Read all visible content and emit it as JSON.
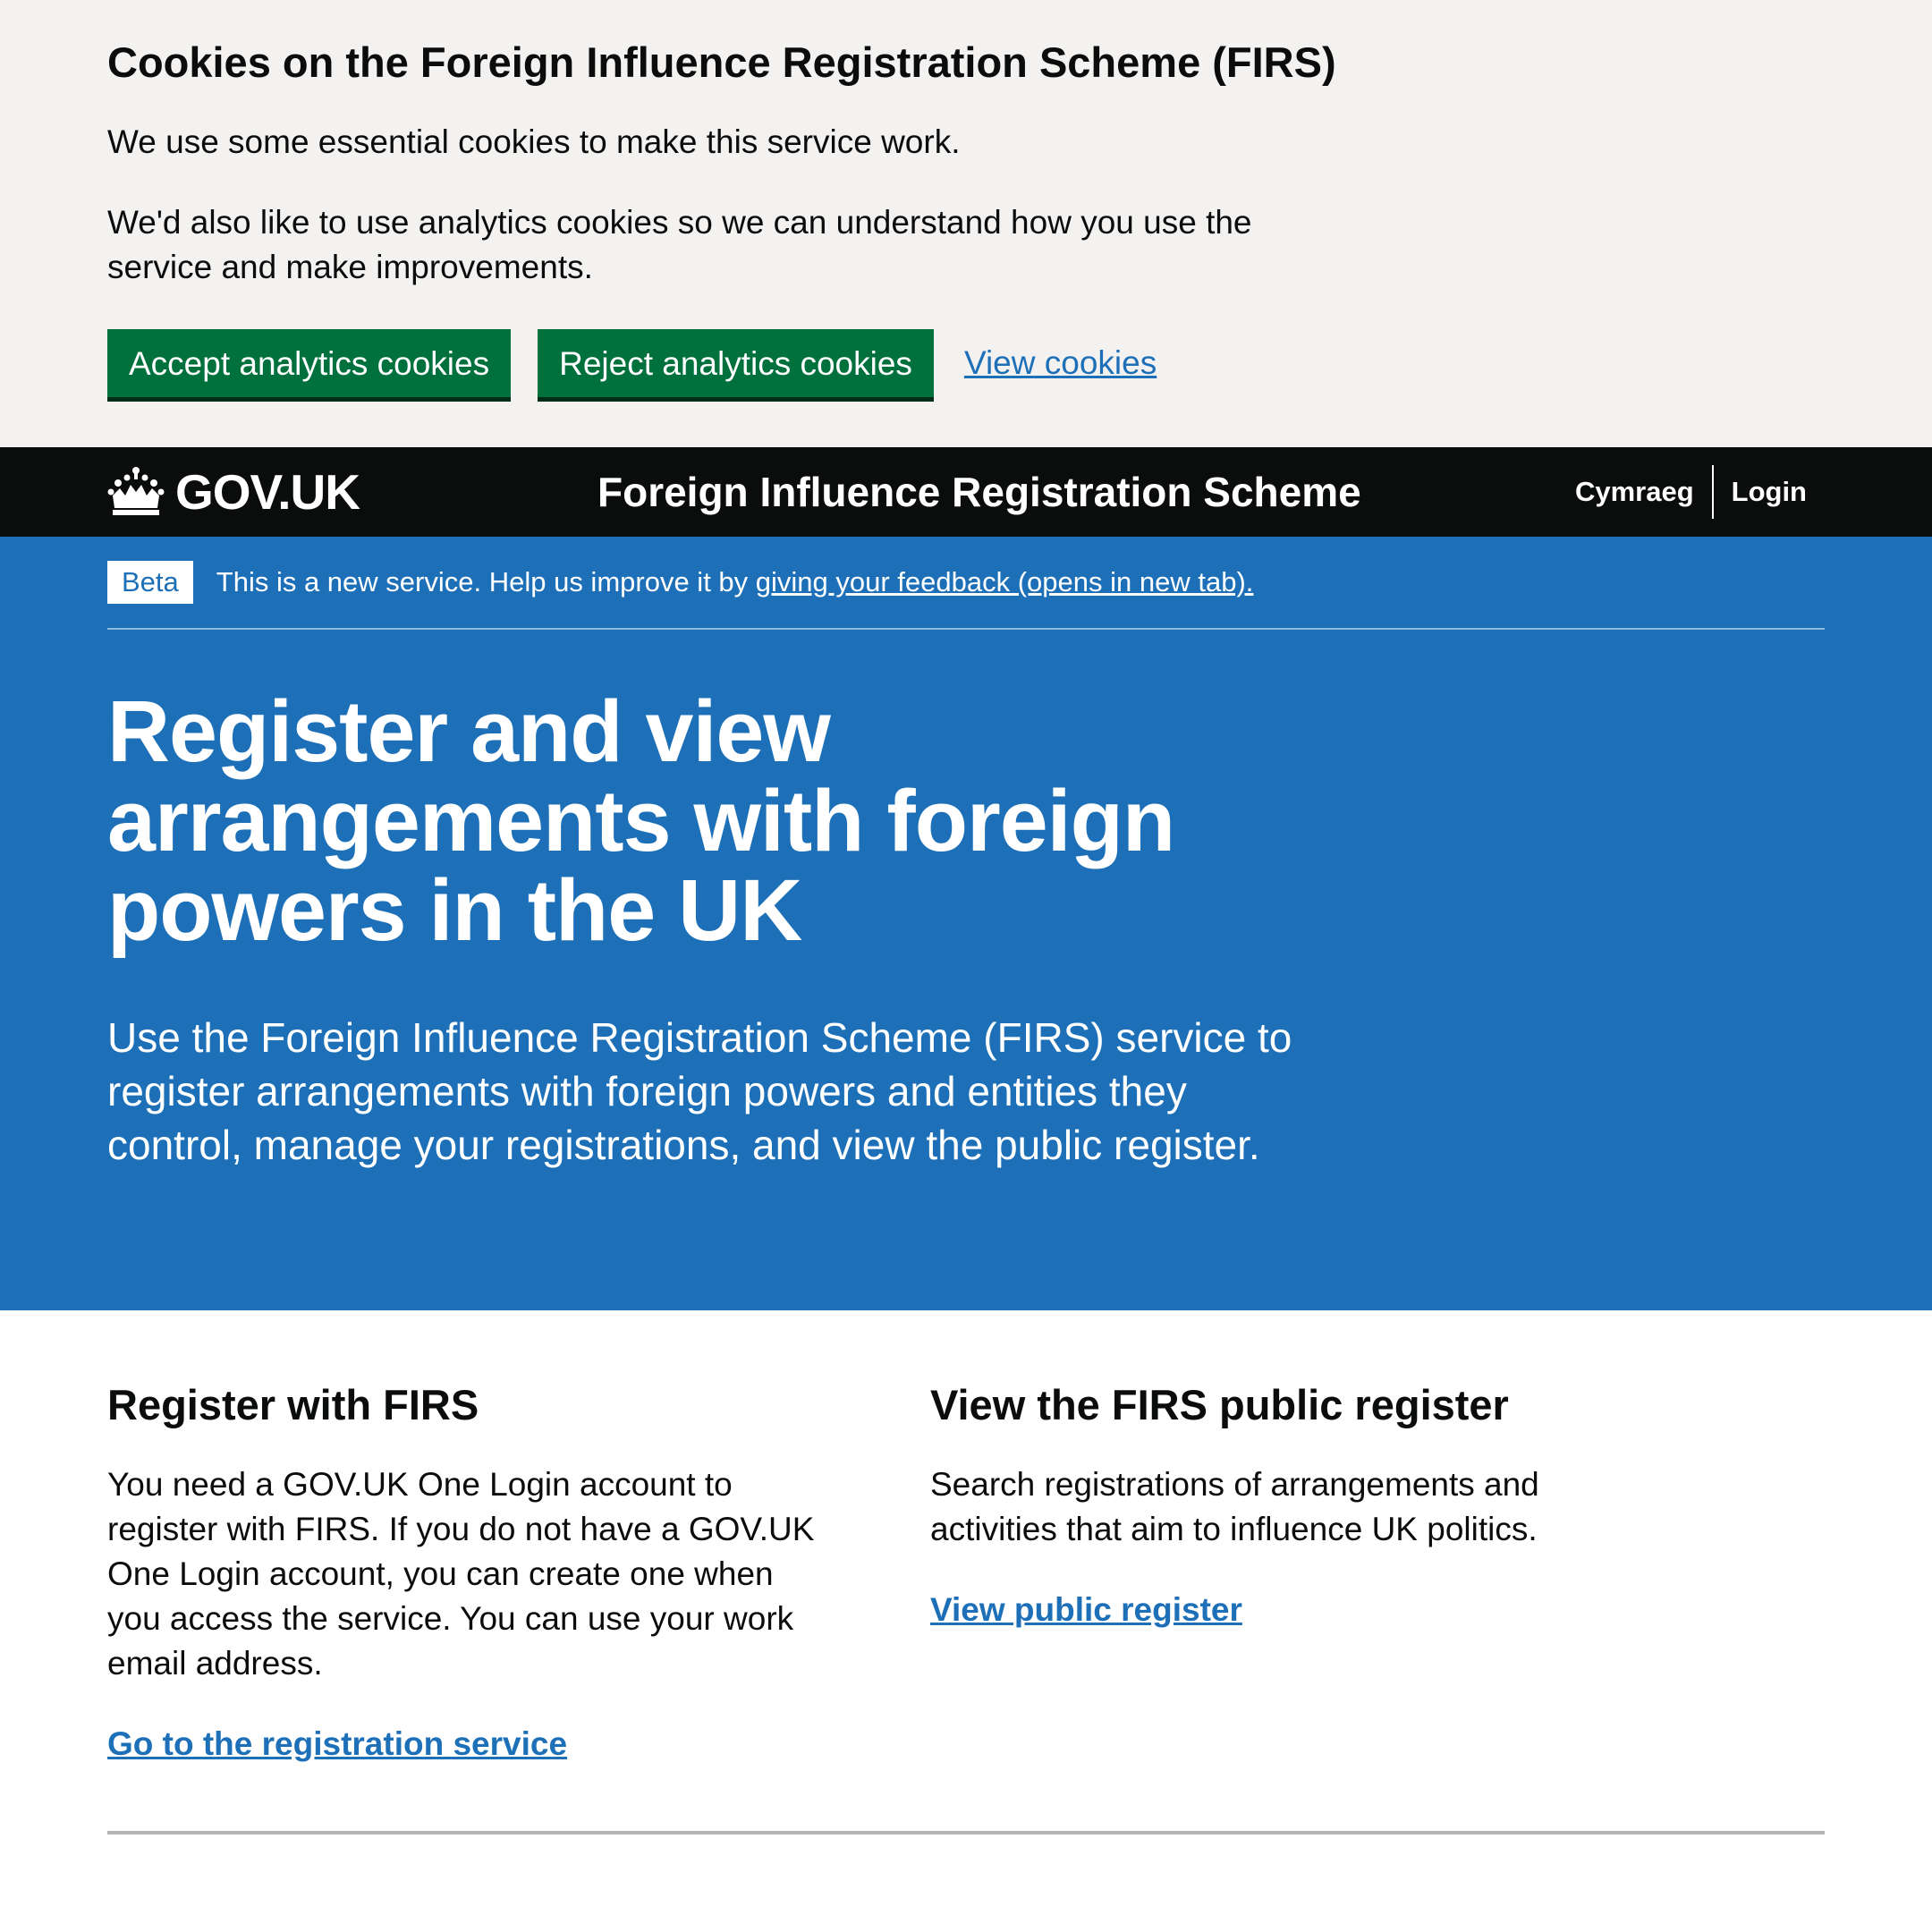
{
  "cookie_banner": {
    "title": "Cookies on the Foreign Influence Registration Scheme (FIRS)",
    "text_1": "We use some essential cookies to make this service work.",
    "text_2": "We'd also like to use analytics cookies so we can understand how you use the service and make improvements.",
    "accept_label": "Accept analytics cookies",
    "reject_label": "Reject analytics cookies",
    "view_label": "View cookies"
  },
  "header": {
    "logo_text": "GOV.UK",
    "service_name": "Foreign Influence Registration Scheme",
    "nav": {
      "language": "Cymraeg",
      "login": "Login"
    }
  },
  "phase_banner": {
    "tag": "Beta",
    "text": "This is a new service. Help us improve it by ",
    "link": "giving your feedback (opens in new tab)."
  },
  "hero": {
    "title": "Register and view arrangements with foreign powers in the UK",
    "lead": "Use the Foreign Influence Registration Scheme (FIRS) service to register arrangements with foreign powers and entities they control, manage your registrations, and view the public register."
  },
  "columns": {
    "register": {
      "heading": "Register with FIRS",
      "body": "You need a GOV.UK One Login account to register with FIRS. If you do not have a GOV.UK One Login account, you can create one when you access the service. You can use your work email address.",
      "link": "Go to the registration service"
    },
    "public_register": {
      "heading": "View the FIRS public register",
      "body": "Search registrations of arrangements and activities that aim to influence UK politics.",
      "link": "View public register"
    }
  },
  "colors": {
    "brand_blue": "#1d70b8",
    "button_green": "#00703c",
    "header_black": "#0b0c0c",
    "banner_grey": "#f3f2f1"
  }
}
